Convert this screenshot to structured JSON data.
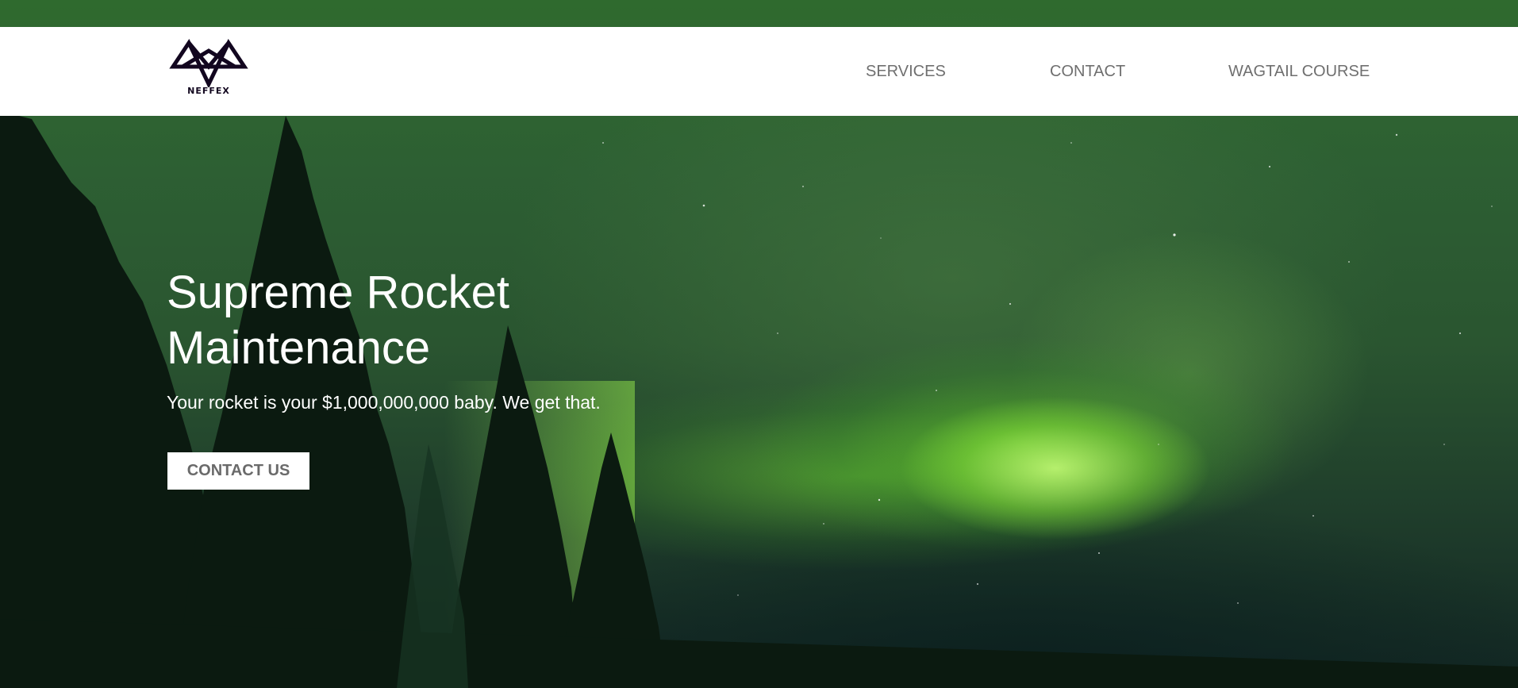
{
  "header": {
    "logo": {
      "icon": "neffex-logo-icon",
      "wordmark": "NEFFEX"
    },
    "nav": [
      {
        "label": "SERVICES"
      },
      {
        "label": "CONTACT"
      },
      {
        "label": "WAGTAIL COURSE"
      }
    ]
  },
  "hero": {
    "title_line1": "Supreme Rocket",
    "title_line2": "Maintenance",
    "subtitle": "Your rocket is your $1,000,000,000 baby. We get that.",
    "cta_label": "CONTACT US",
    "background": "aurora-night-sky-image"
  },
  "colors": {
    "header_bg": "#ffffff",
    "nav_text": "#6f6f6f",
    "hero_text": "#ffffff",
    "cta_bg": "#ffffff",
    "cta_text": "#6a6a6a",
    "logo": "#12061f"
  }
}
